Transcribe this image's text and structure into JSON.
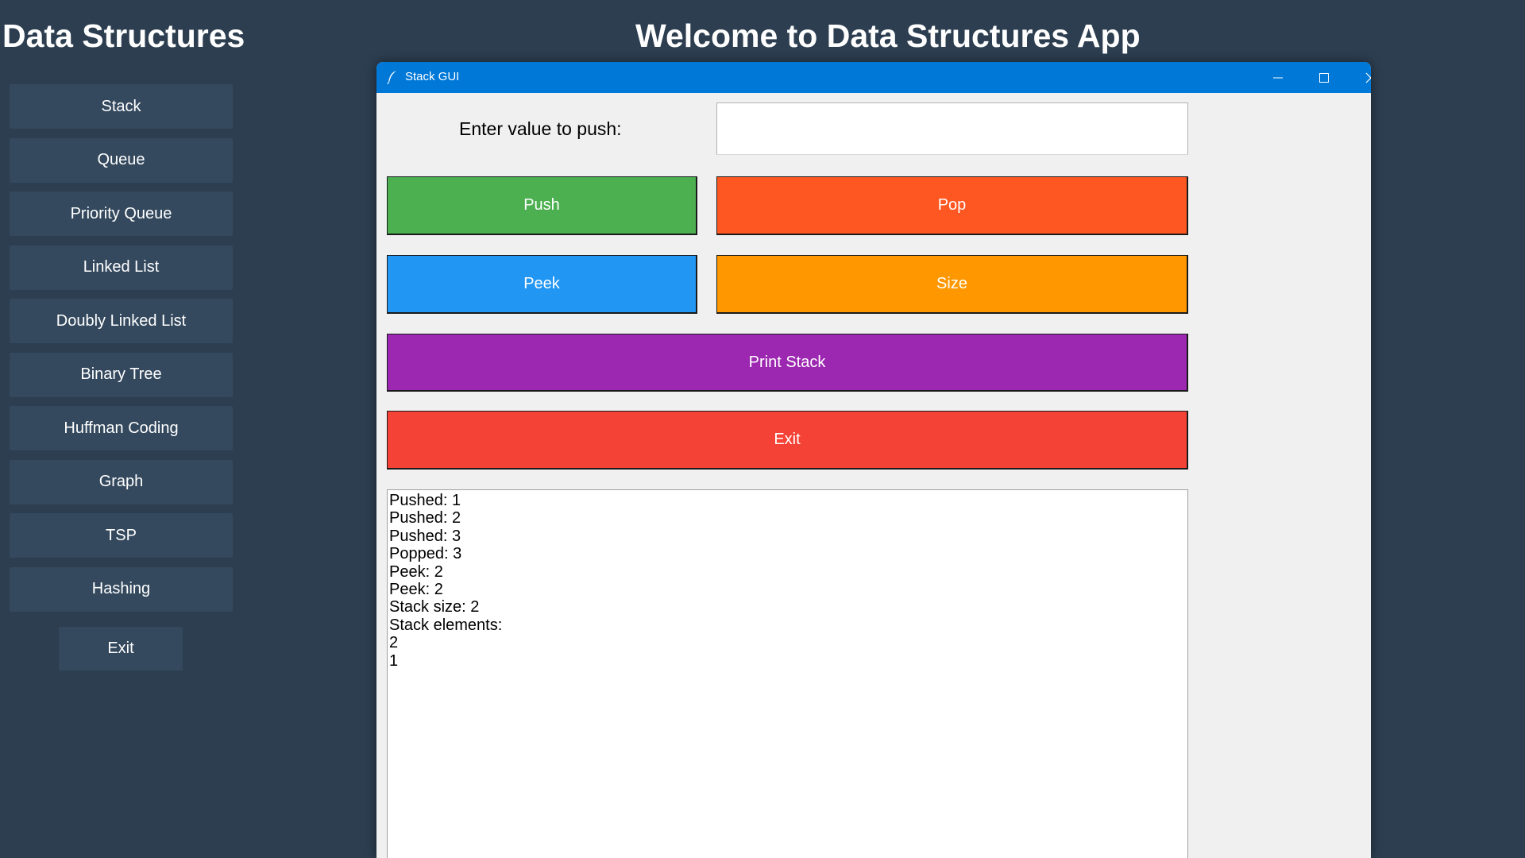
{
  "main_window": {
    "title": "Data Structures",
    "welcome": "Welcome to Data Structures App",
    "sidebar": {
      "items": [
        {
          "label": "Stack"
        },
        {
          "label": "Queue"
        },
        {
          "label": "Priority Queue"
        },
        {
          "label": "Linked List"
        },
        {
          "label": "Doubly Linked List"
        },
        {
          "label": "Binary Tree"
        },
        {
          "label": "Huffman Coding"
        },
        {
          "label": "Graph"
        },
        {
          "label": "TSP"
        },
        {
          "label": "Hashing"
        }
      ],
      "exit_label": "Exit"
    }
  },
  "stack_window": {
    "title": "Stack GUI",
    "icon": "feather-icon",
    "controls": {
      "minimize": "minimize-icon",
      "maximize": "maximize-icon",
      "close": "close-icon"
    },
    "input_label": "Enter value to push:",
    "input_value": "",
    "buttons": {
      "push": "Push",
      "pop": "Pop",
      "peek": "Peek",
      "size": "Size",
      "print": "Print Stack",
      "exit": "Exit"
    },
    "output_lines": [
      "Pushed: 1",
      "Pushed: 2",
      "Pushed: 3",
      "Popped: 3",
      "Peek: 2",
      "Peek: 2",
      "Stack size: 2",
      "Stack elements:",
      "2",
      "1"
    ]
  },
  "colors": {
    "background": "#2c3e50",
    "sidebar_button": "#34495e",
    "titlebar": "#0078d7",
    "push": "#4caf50",
    "pop": "#ff5722",
    "peek": "#2196f3",
    "size": "#ff9800",
    "print": "#9c27b0",
    "exit": "#f44336"
  }
}
